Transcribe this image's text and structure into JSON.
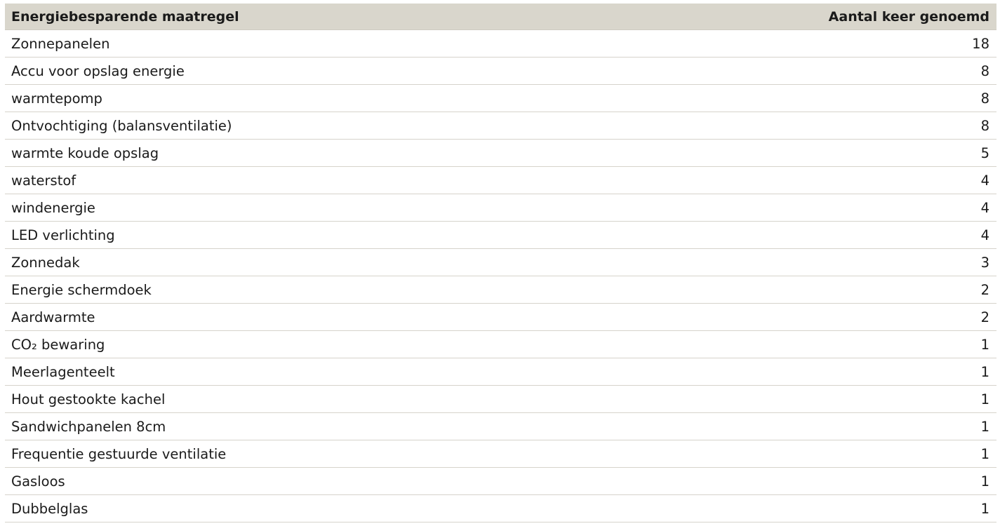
{
  "table": {
    "headers": {
      "measure": "Energiebesparende maatregel",
      "count": "Aantal keer genoemd"
    },
    "rows": [
      {
        "measure": "Zonnepanelen",
        "count": "18"
      },
      {
        "measure": "Accu voor opslag energie",
        "count": "8"
      },
      {
        "measure": "warmtepomp",
        "count": "8"
      },
      {
        "measure": "Ontvochtiging (balansventilatie)",
        "count": "8"
      },
      {
        "measure": "warmte koude opslag",
        "count": "5"
      },
      {
        "measure": "waterstof",
        "count": "4"
      },
      {
        "measure": "windenergie",
        "count": "4"
      },
      {
        "measure": "LED verlichting",
        "count": "4"
      },
      {
        "measure": "Zonnedak",
        "count": "3"
      },
      {
        "measure": "Energie schermdoek",
        "count": "2"
      },
      {
        "measure": "Aardwarmte",
        "count": "2"
      },
      {
        "measure": "CO₂ bewaring",
        "count": "1"
      },
      {
        "measure": "Meerlagenteelt",
        "count": "1"
      },
      {
        "measure": "Hout gestookte kachel",
        "count": "1"
      },
      {
        "measure": "Sandwichpanelen 8cm",
        "count": "1"
      },
      {
        "measure": "Frequentie gestuurde ventilatie",
        "count": "1"
      },
      {
        "measure": "Gasloos",
        "count": "1"
      },
      {
        "measure": "Dubbelglas",
        "count": "1"
      }
    ]
  },
  "colors": {
    "header_bg": "#d9d6cc",
    "row_border": "#d6d3cb",
    "text": "#1a1a1a"
  }
}
